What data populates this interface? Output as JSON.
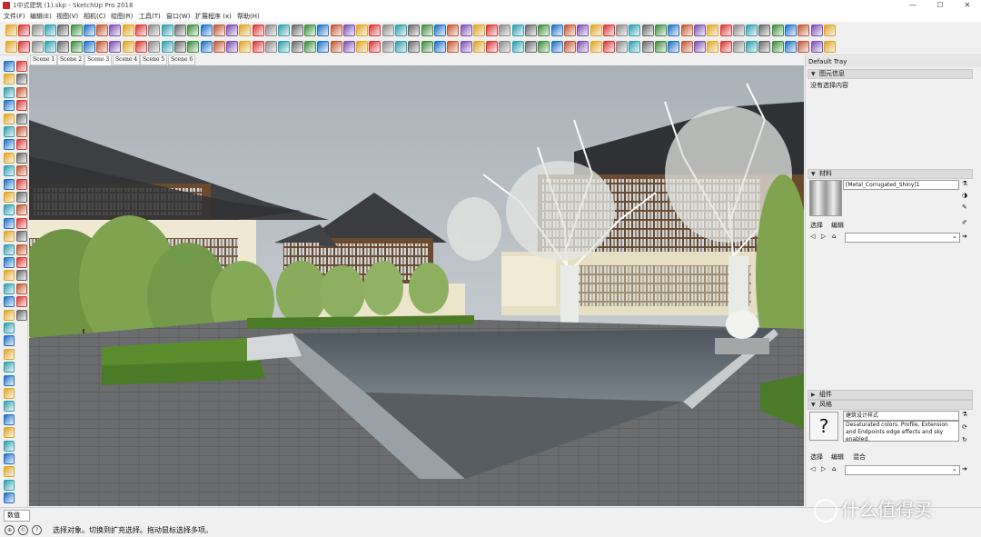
{
  "window": {
    "title": "1中式建筑 (1).skp - SketchUp Pro 2018",
    "controls": {
      "minimize": "—",
      "maximize": "☐",
      "close": "✕"
    }
  },
  "menu": [
    "文件(F)",
    "编辑(E)",
    "视图(V)",
    "相机(C)",
    "绘图(R)",
    "工具(T)",
    "窗口(W)",
    "扩展程序 (x)",
    "帮助(H)"
  ],
  "scenes": {
    "tabs": [
      "Scene 1",
      "Scene 2",
      "Scene 3",
      "Scene 4",
      "Scene 5",
      "Scene 6"
    ],
    "active_index": 2
  },
  "tray": {
    "title": "Default Tray",
    "entity_info": {
      "header": "图元信息",
      "content": "没有选择内容"
    },
    "materials": {
      "header": "材料",
      "name": "[Metal_Corrugated_Shiny]1",
      "tabs": [
        "选择",
        "编辑"
      ]
    },
    "components": {
      "header": "组件"
    },
    "styles": {
      "header": "风格",
      "name": "建筑设计样式",
      "description": "Desaturated colors. Profile, Extension and Endpoints edge effects and sky enabled.",
      "tabs": [
        "选择",
        "编辑",
        "混合"
      ]
    }
  },
  "status": {
    "vcb_label": "数值",
    "message": "选择对象。切换到扩充选择。拖动鼠标选择多项。",
    "icons": [
      "geo-icon",
      "credits-icon",
      "help-icon"
    ]
  },
  "watermark": "什么值得买",
  "colors": {
    "accent": "#1a6fc9",
    "sky": "#b8bfc5",
    "foliage": "#7fa34e",
    "water": "#5a6268"
  }
}
